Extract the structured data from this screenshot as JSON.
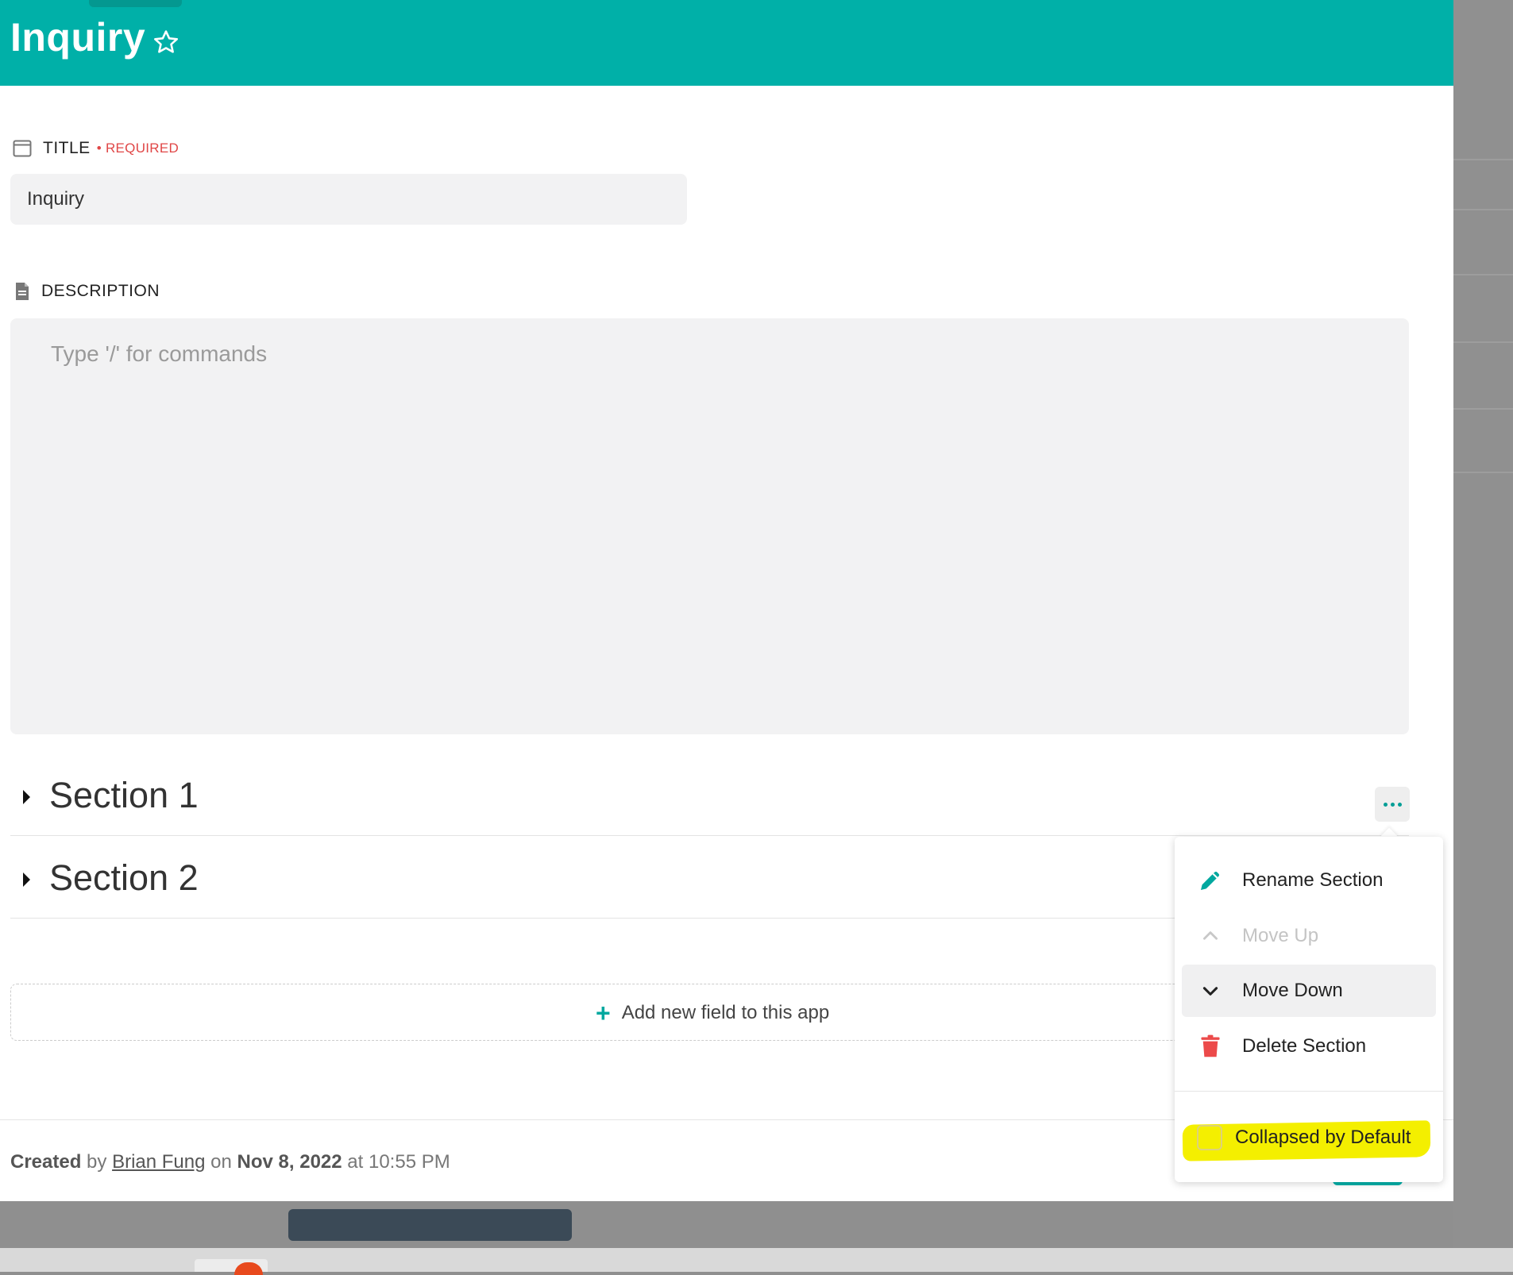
{
  "header": {
    "title": "Inquiry"
  },
  "title_field": {
    "label": "TITLE",
    "required": "• REQUIRED",
    "value": "Inquiry"
  },
  "description_field": {
    "label": "DESCRIPTION",
    "placeholder": "Type '/' for commands"
  },
  "sections": [
    {
      "title": "Section 1"
    },
    {
      "title": "Section 2"
    }
  ],
  "add_field": {
    "label": "Add new field to this app"
  },
  "section_menu": {
    "items": [
      {
        "label": "Rename Section",
        "icon": "pencil-icon",
        "state": "enabled"
      },
      {
        "label": "Move Up",
        "icon": "chevron-up-icon",
        "state": "disabled"
      },
      {
        "label": "Move Down",
        "icon": "chevron-down-icon",
        "state": "hovered"
      },
      {
        "label": "Delete Section",
        "icon": "trash-icon",
        "state": "enabled"
      }
    ],
    "collapsed_label": "Collapsed by Default",
    "collapsed_checked": false
  },
  "footer": {
    "created": "Created",
    "by": "by",
    "author": "Brian Fung",
    "on": "on",
    "date": "Nov 8, 2022",
    "at": "at",
    "time": "10:55 PM"
  },
  "colors": {
    "header": "#00b0a8",
    "accent": "#00a89f",
    "required": "#e04646",
    "delete": "#ec4a4a",
    "highlight": "#f4ef00"
  }
}
